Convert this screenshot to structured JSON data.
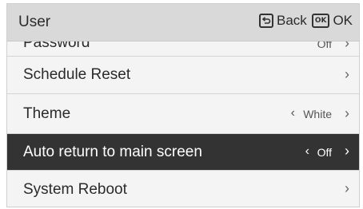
{
  "header": {
    "title": "User",
    "back_label": "Back",
    "ok_icon_text": "OK",
    "ok_label": "OK"
  },
  "menu": {
    "items": [
      {
        "label": "Password",
        "value": "Off"
      },
      {
        "label": "Schedule Reset"
      },
      {
        "label": "Theme",
        "value": "White"
      },
      {
        "label": "Auto return to main screen",
        "value": "Off",
        "selected": true
      },
      {
        "label": "System Reboot"
      }
    ]
  },
  "colors": {
    "header_bg": "#d9d9d9",
    "row_bg": "#f4f4f4",
    "selected_bg": "#333333"
  }
}
